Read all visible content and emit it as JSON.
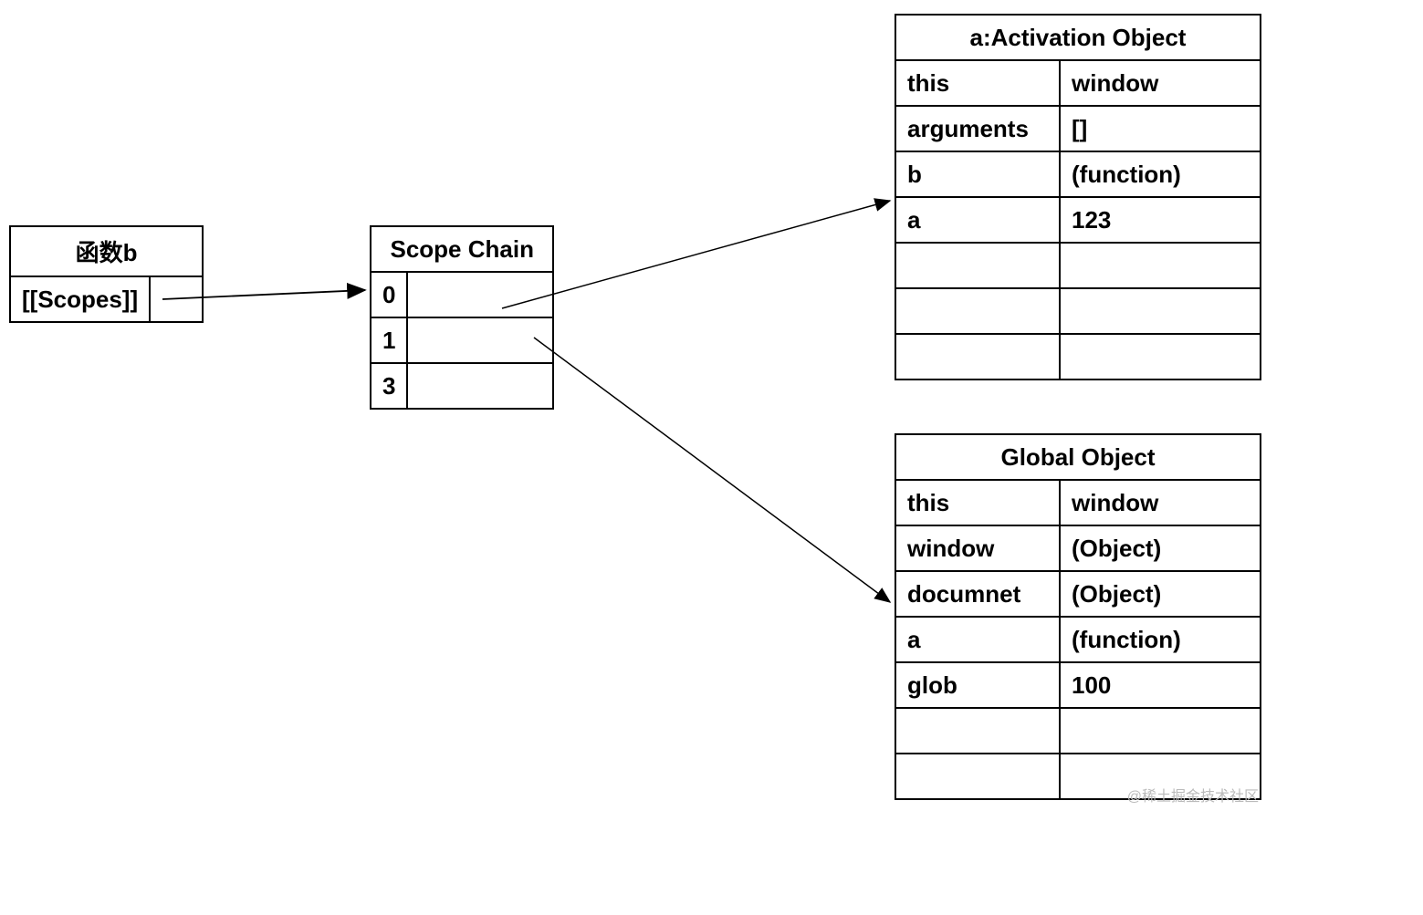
{
  "functionB": {
    "title": "函数b",
    "scopesLabel": "[[Scopes]]"
  },
  "scopeChain": {
    "title": "Scope Chain",
    "rows": [
      {
        "index": "0"
      },
      {
        "index": "1"
      },
      {
        "index": "3"
      }
    ]
  },
  "activationObject": {
    "title": "a:Activation Object",
    "rows": [
      {
        "key": "this",
        "value": "window"
      },
      {
        "key": "arguments",
        "value": "[]"
      },
      {
        "key": "b",
        "value": "(function)"
      },
      {
        "key": "a",
        "value": "123"
      },
      {
        "key": "",
        "value": ""
      },
      {
        "key": "",
        "value": ""
      },
      {
        "key": "",
        "value": ""
      }
    ]
  },
  "globalObject": {
    "title": "Global Object",
    "rows": [
      {
        "key": "this",
        "value": "window"
      },
      {
        "key": "window",
        "value": "(Object)"
      },
      {
        "key": "documnet",
        "value": "(Object)"
      },
      {
        "key": "a",
        "value": "(function)"
      },
      {
        "key": "glob",
        "value": "100"
      },
      {
        "key": "",
        "value": ""
      },
      {
        "key": "",
        "value": ""
      }
    ]
  },
  "watermark": "@稀土掘金技术社区"
}
